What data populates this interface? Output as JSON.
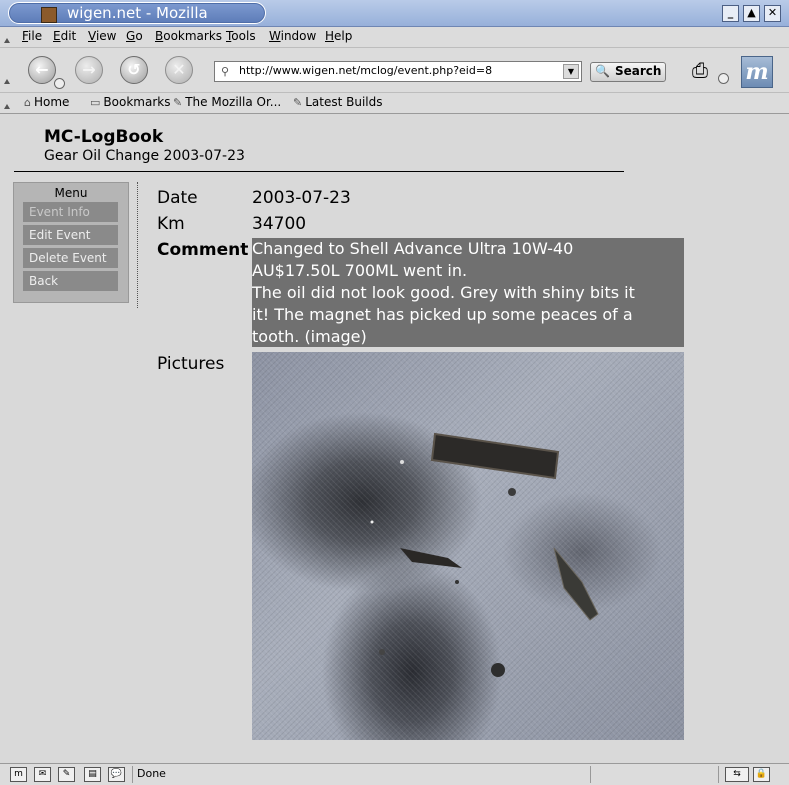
{
  "window": {
    "title": "wigen.net - Mozilla"
  },
  "menubar": {
    "items": [
      "File",
      "Edit",
      "View",
      "Go",
      "Bookmarks",
      "Tools",
      "Window",
      "Help"
    ]
  },
  "navbar": {
    "url": "http://www.wigen.net/mclog/event.php?eid=8",
    "search_label": "Search"
  },
  "personal_toolbar": {
    "items": [
      "Home",
      "Bookmarks",
      "The Mozilla Or...",
      "Latest Builds"
    ]
  },
  "page": {
    "title": "MC-LogBook",
    "subtitle": "Gear Oil Change 2003-07-23"
  },
  "sidebar": {
    "heading": "Menu",
    "items": [
      "Event Info",
      "Edit Event",
      "Delete Event",
      "Back"
    ]
  },
  "event": {
    "date_label": "Date",
    "date": "2003-07-23",
    "km_label": "Km",
    "km": "34700",
    "comment_label": "Comment",
    "comment_lines": [
      "Changed to Shell Advance Ultra 10W-40",
      "AU$17.50L 700ML went in.",
      "The oil did not look good. Grey with shiny bits it",
      "it! The magnet has picked up some peaces of a",
      "tooth. (image)"
    ],
    "pictures_label": "Pictures"
  },
  "statusbar": {
    "text": "Done"
  }
}
